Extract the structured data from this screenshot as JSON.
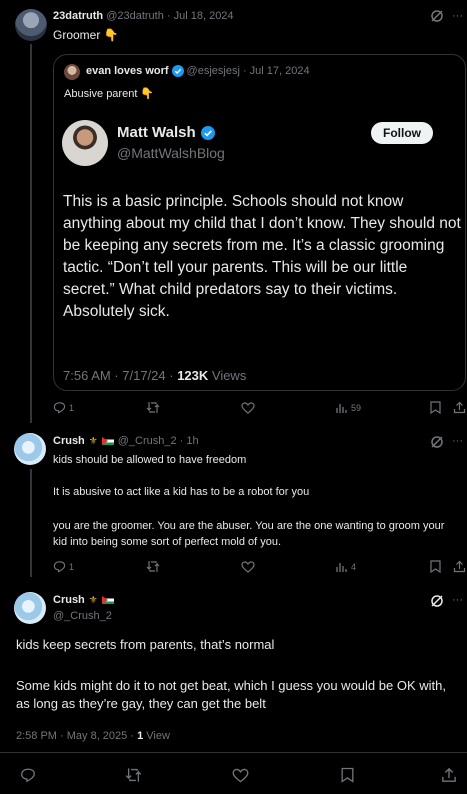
{
  "tweet1": {
    "display_name": "23datruth",
    "handle_date": "@23datruth · Jul 18, 2024",
    "text": "Groomer 👇"
  },
  "quote": {
    "display_name": "evan loves worf",
    "handle_date": "@esjesjesj · Jul 17, 2024",
    "text": "Abusive parent 👇"
  },
  "embedded": {
    "display_name": "Matt Walsh",
    "handle": "@MattWalshBlog",
    "follow_label": "Follow",
    "body": "This is a basic principle. Schools should not know anything about my child that I don’t know. They should not be keeping any secrets from me. It’s a classic grooming tactic. “Don’t tell your parents. This will be our little secret.” What child predators say to their victims. Absolutely sick.",
    "timestamp": "7:56 AM · 7/17/24 · ",
    "views_count": "123K",
    "views_label": " Views"
  },
  "tweet1_actions": {
    "replies": "1",
    "views": "59"
  },
  "tweet2": {
    "display_name": "Crush",
    "handle_time": "@_Crush_2 · 1h",
    "p1": "kids should be allowed to have freedom",
    "p2": "It is abusive to act like a kid has to be a robot for you",
    "p3": "you are the groomer. You are the abuser. You are the one wanting to groom your kid into being some sort of perfect mold of you."
  },
  "tweet2_actions": {
    "replies": "1",
    "views": "4"
  },
  "tweet3": {
    "display_name": "Crush",
    "handle": "@_Crush_2",
    "p1": "kids keep secrets from parents, that’s normal",
    "p2": "Some kids might do it to not get beat, which I guess you would be OK with, as long as they’re gay, they can get the belt",
    "timestamp": "2:58 PM · May 8, 2025 · ",
    "views_count": "1",
    "views_label": " View"
  },
  "colors": {
    "background": "#000000",
    "text": "#e7e9ea",
    "muted": "#71767b",
    "verified": "#1d9bf0",
    "border": "#2f3336"
  },
  "icons": [
    "grok-icon",
    "more-icon",
    "reply-icon",
    "retweet-icon",
    "like-icon",
    "views-icon",
    "bookmark-icon",
    "share-icon",
    "verified-badge-icon"
  ]
}
